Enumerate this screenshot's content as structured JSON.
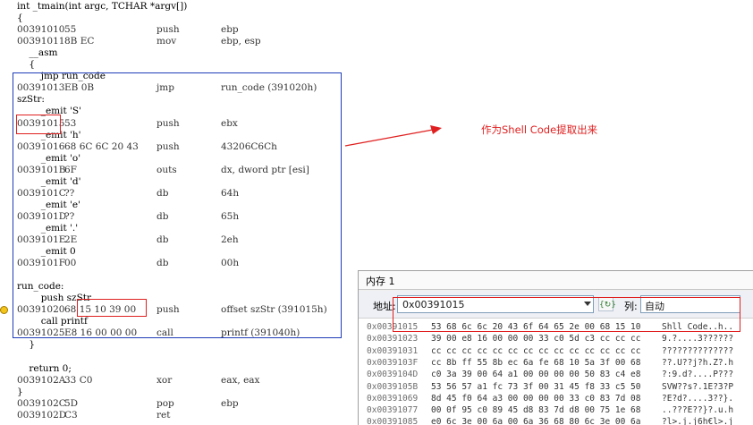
{
  "disassembly": {
    "lines": [
      {
        "src": "int _tmain(int argc, TCHAR *argv[])"
      },
      {
        "src": "{"
      },
      {
        "addr": "00391010",
        "bytes": "55",
        "mnemonic": "push",
        "operand": "ebp"
      },
      {
        "addr": "00391011",
        "bytes": "8B EC",
        "mnemonic": "mov",
        "operand": "ebp, esp"
      },
      {
        "src": "    __asm",
        "indent": 1
      },
      {
        "src": "    {",
        "indent": 1
      },
      {
        "src": "        jmp run_code",
        "indent": 2
      },
      {
        "addr": "00391013",
        "bytes": "EB 0B",
        "mnemonic": "jmp",
        "operand": "run_code (391020h)"
      },
      {
        "src": "szStr:"
      },
      {
        "src": "        _emit 'S'",
        "indent": 2
      },
      {
        "addr": "00391015",
        "bytes": "53",
        "mnemonic": "push",
        "operand": "ebx"
      },
      {
        "src": "        _emit 'h'",
        "indent": 2
      },
      {
        "addr": "00391016",
        "bytes": "68 6C 6C 20 43",
        "mnemonic": "push",
        "operand": "43206C6Ch"
      },
      {
        "src": "        _emit 'o'",
        "indent": 2
      },
      {
        "addr": "0039101B",
        "bytes": "6F",
        "mnemonic": "outs",
        "operand": "dx, dword ptr [esi]"
      },
      {
        "src": "        _emit 'd'",
        "indent": 2
      },
      {
        "addr": "0039101C",
        "bytes": "??",
        "mnemonic": "db",
        "operand": "64h"
      },
      {
        "src": "        _emit 'e'",
        "indent": 2
      },
      {
        "addr": "0039101D",
        "bytes": "??",
        "mnemonic": "db",
        "operand": "65h"
      },
      {
        "src": "        _emit '.'",
        "indent": 2
      },
      {
        "addr": "0039101E",
        "bytes": "2E",
        "mnemonic": "db",
        "operand": "2eh"
      },
      {
        "src": "        _emit 0",
        "indent": 2
      },
      {
        "addr": "0039101F",
        "bytes": "00",
        "mnemonic": "db",
        "operand": "00h"
      },
      {
        "src": ""
      },
      {
        "src": "run_code:"
      },
      {
        "src": "        push szStr",
        "indent": 2
      },
      {
        "addr": "00391020",
        "bytes": "68 15 10 39 00",
        "mnemonic": "push",
        "operand": "offset szStr (391015h)"
      },
      {
        "src": "        call printf",
        "indent": 2
      },
      {
        "addr": "00391025",
        "bytes": "E8 16 00 00 00",
        "mnemonic": "call",
        "operand": "printf (391040h)"
      },
      {
        "src": "    }",
        "indent": 1
      },
      {
        "src": ""
      },
      {
        "src": "    return 0;",
        "indent": 1
      },
      {
        "addr": "0039102A",
        "bytes": "33 C0",
        "mnemonic": "xor",
        "operand": "eax, eax"
      },
      {
        "src": "}"
      },
      {
        "addr": "0039102C",
        "bytes": "5D",
        "mnemonic": "pop",
        "operand": "ebp"
      },
      {
        "addr": "0039102D",
        "bytes": "C3",
        "mnemonic": "ret",
        "operand": ""
      }
    ]
  },
  "annotation": {
    "text": "作为Shell Code提取出来",
    "color": "#e02020"
  },
  "memory_window": {
    "title": "内存 1",
    "address_label": "地址:",
    "address_value": "0x00391015",
    "go_icon": "refresh-go-icon",
    "column_label": "列:",
    "column_value": "自动",
    "rows": [
      {
        "addr": "0x00391015",
        "hex": "53 68 6c 6c 20 43 6f 64 65 2e 00 68 15 10",
        "ascii": "Shll Code..h.."
      },
      {
        "addr": "0x00391023",
        "hex": "39 00 e8 16 00 00 00 33 c0 5d c3 cc cc cc",
        "ascii": "9.?....3??????"
      },
      {
        "addr": "0x00391031",
        "hex": "cc cc cc cc cc cc cc cc cc cc cc cc cc cc",
        "ascii": "??????????????"
      },
      {
        "addr": "0x0039103F",
        "hex": "cc 8b ff 55 8b ec 6a fe 68 10 5a 3f 00 68",
        "ascii": "??.U??j?h.Z?.h"
      },
      {
        "addr": "0x0039104D",
        "hex": "c0 3a 39 00 64 a1 00 00 00 00 50 83 c4 e8",
        "ascii": "?:9.d?....P???"
      },
      {
        "addr": "0x0039105B",
        "hex": "53 56 57 a1 fc 73 3f 00 31 45 f8 33 c5 50",
        "ascii": "SVW??s?.1E?3?P"
      },
      {
        "addr": "0x00391069",
        "hex": "8d 45 f0 64 a3 00 00 00 00 33 c0 83 7d 08",
        "ascii": "?E?d?....3??}."
      },
      {
        "addr": "0x00391077",
        "hex": "00 0f 95 c0 89 45 d8 83 7d d8 00 75 1e 68",
        "ascii": "..???E??}?.u.h"
      },
      {
        "addr": "0x00391085",
        "hex": "e0 6c 3e 00 6a 00 6a 36 68 80 6c 3e 00 6a",
        "ascii": "?l>.j.j6h€l>.j"
      }
    ]
  },
  "colors": {
    "block_border": "#1f3cb8",
    "highlight_border": "#e02020",
    "breakpoint": "#f3c41a"
  }
}
